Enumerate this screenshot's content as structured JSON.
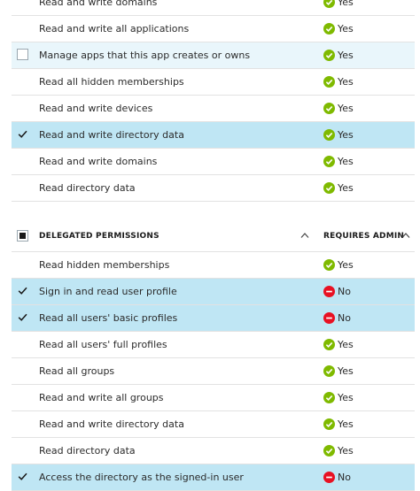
{
  "app_permissions": {
    "rows": [
      {
        "label": "Read and write domains",
        "value": "Yes",
        "checked": false,
        "state": "normal"
      },
      {
        "label": "Read and write all applications",
        "value": "Yes",
        "checked": false,
        "state": "normal"
      },
      {
        "label": "Manage apps that this app creates or owns",
        "value": "Yes",
        "checked": false,
        "state": "hover"
      },
      {
        "label": "Read all hidden memberships",
        "value": "Yes",
        "checked": false,
        "state": "normal"
      },
      {
        "label": "Read and write devices",
        "value": "Yes",
        "checked": false,
        "state": "normal"
      },
      {
        "label": "Read and write directory data",
        "value": "Yes",
        "checked": true,
        "state": "selected"
      },
      {
        "label": "Read and write domains",
        "value": "Yes",
        "checked": false,
        "state": "normal"
      },
      {
        "label": "Read directory data",
        "value": "Yes",
        "checked": false,
        "state": "normal"
      }
    ]
  },
  "delegated": {
    "header": {
      "title": "DELEGATED PERMISSIONS",
      "requires_admin": "REQUIRES ADMIN"
    },
    "rows": [
      {
        "label": "Read hidden memberships",
        "value": "Yes",
        "checked": false,
        "state": "normal"
      },
      {
        "label": "Sign in and read user profile",
        "value": "No",
        "checked": true,
        "state": "selected"
      },
      {
        "label": "Read all users' basic profiles",
        "value": "No",
        "checked": true,
        "state": "selected"
      },
      {
        "label": "Read all users' full profiles",
        "value": "Yes",
        "checked": false,
        "state": "normal"
      },
      {
        "label": "Read all groups",
        "value": "Yes",
        "checked": false,
        "state": "normal"
      },
      {
        "label": "Read and write all groups",
        "value": "Yes",
        "checked": false,
        "state": "normal"
      },
      {
        "label": "Read and write directory data",
        "value": "Yes",
        "checked": false,
        "state": "normal"
      },
      {
        "label": "Read directory data",
        "value": "Yes",
        "checked": false,
        "state": "normal"
      },
      {
        "label": "Access the directory as the signed-in user",
        "value": "No",
        "checked": true,
        "state": "selected"
      }
    ]
  },
  "icons": {
    "yes": "green-check-circle-icon",
    "no": "red-minus-circle-icon",
    "checkbox_checked": "checkmark-icon",
    "sort": "chevron-up-icon"
  },
  "colors": {
    "selected_row": "#bfe6f4",
    "hover_row": "#e9f6fb",
    "yes_green": "#7fba00",
    "no_red": "#e81123"
  }
}
